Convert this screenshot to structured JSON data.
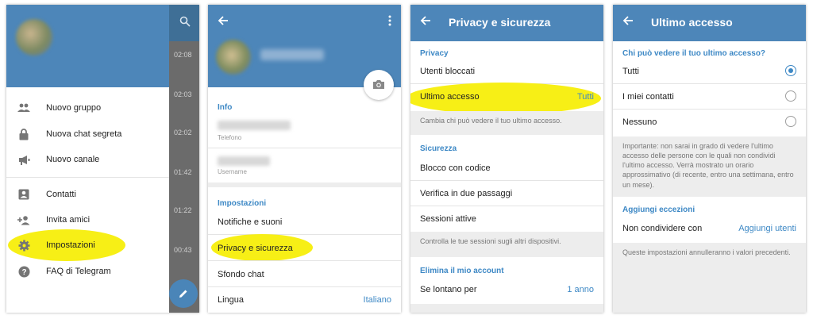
{
  "drawer": {
    "items": [
      {
        "label": "Nuovo gruppo",
        "icon": "group-icon"
      },
      {
        "label": "Nuova chat segreta",
        "icon": "lock-icon"
      },
      {
        "label": "Nuovo canale",
        "icon": "megaphone-icon"
      },
      {
        "label": "Contatti",
        "icon": "contacts-icon"
      },
      {
        "label": "Invita amici",
        "icon": "add-person-icon"
      },
      {
        "label": "Impostazioni",
        "icon": "gear-icon"
      },
      {
        "label": "FAQ di Telegram",
        "icon": "help-icon"
      }
    ],
    "chat_times": [
      "02:08",
      "02:03",
      "02:02",
      "01:42",
      "01:22",
      "00:43"
    ]
  },
  "settings": {
    "info_title": "Info",
    "phone_label": "Telefono",
    "username_label": "Username",
    "settings_title": "Impostazioni",
    "items": [
      {
        "label": "Notifiche e suoni"
      },
      {
        "label": "Privacy e sicurezza"
      },
      {
        "label": "Sfondo chat"
      },
      {
        "label": "Lingua",
        "value": "Italiano"
      }
    ]
  },
  "privacy": {
    "title": "Privacy e sicurezza",
    "privacy_section": "Privacy",
    "blocked_users": "Utenti bloccati",
    "last_seen": "Ultimo accesso",
    "last_seen_value": "Tutti",
    "last_seen_hint": "Cambia chi può vedere il tuo ultimo accesso.",
    "security_section": "Sicurezza",
    "passcode": "Blocco con codice",
    "two_step": "Verifica in due passaggi",
    "sessions": "Sessioni attive",
    "sessions_hint": "Controlla le tue sessioni sugli altri dispositivi.",
    "delete_section": "Elimina il mio account",
    "if_away": "Se lontano per",
    "if_away_value": "1 anno"
  },
  "last_seen": {
    "title": "Ultimo accesso",
    "question": "Chi può vedere il tuo ultimo accesso?",
    "options": [
      {
        "label": "Tutti",
        "selected": true
      },
      {
        "label": "I miei contatti",
        "selected": false
      },
      {
        "label": "Nessuno",
        "selected": false
      }
    ],
    "note": "Importante: non sarai in grado di vedere l'ultimo accesso delle persone con le quali non condividi l'ultimo accesso. Verrà mostrato un orario approssimativo (di recente, entro una settimana, entro un mese).",
    "exceptions_title": "Aggiungi eccezioni",
    "never_share": "Non condividere con",
    "add_users": "Aggiungi utenti",
    "exceptions_hint": "Queste impostazioni annulleranno i valori precedenti."
  },
  "colors": {
    "header_blue": "#4d86b9",
    "accent_blue": "#3d88c5",
    "highlight_yellow": "#f7ef16"
  }
}
